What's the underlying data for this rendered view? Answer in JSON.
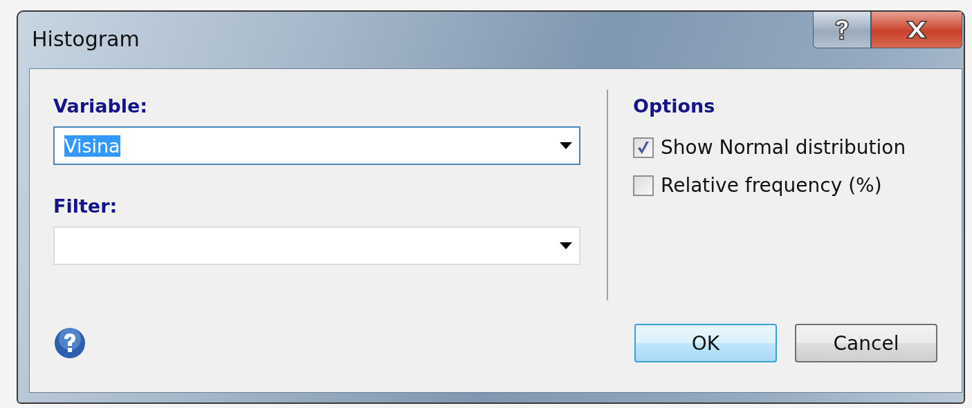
{
  "window": {
    "title": "Histogram"
  },
  "fields": [
    {
      "label": "Variable:",
      "value": "Visina",
      "text_selected": true
    },
    {
      "label": "Filter:"
    }
  ],
  "options": {
    "title": "Options",
    "checkboxes": [
      {
        "label": "Show Normal distribution",
        "checked": true
      },
      {
        "label": "Relative frequency (%)",
        "checked": false
      }
    ]
  },
  "buttons": [
    {
      "label": "OK",
      "default": true
    },
    {
      "label": "Cancel",
      "default": false
    }
  ]
}
